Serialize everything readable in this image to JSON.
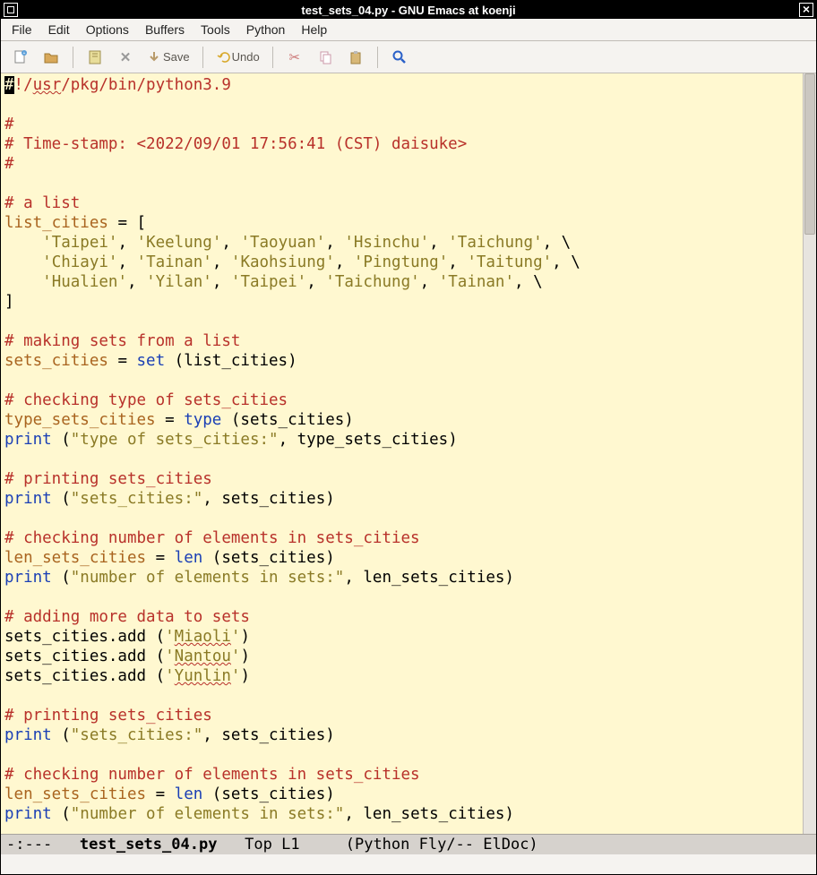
{
  "titlebar": {
    "title": "test_sets_04.py - GNU Emacs at koenji"
  },
  "menu": {
    "file": "File",
    "edit": "Edit",
    "options": "Options",
    "buffers": "Buffers",
    "tools": "Tools",
    "python": "Python",
    "help": "Help"
  },
  "toolbar": {
    "save": "Save",
    "undo": "Undo"
  },
  "modeline": {
    "left": "-:--- ",
    "buffer": "test_sets_04.py",
    "pos": "   Top L1     ",
    "mode": "(Python Fly/-- ElDoc)"
  },
  "code": {
    "shebang_pre": "!/",
    "shebang_usr": "usr",
    "shebang_post": "/pkg/bin/python3.9",
    "blank": " ",
    "hash": "#",
    "timestamp": "# Time-stamp: <2022/09/01 17:56:41 (CST) daisuke>",
    "c_alist": "# a list",
    "list_decl": "list_cities",
    "eq_open": " = [",
    "row1_i": "    ",
    "s_taipei": "'Taipei'",
    "s_keelung": "'Keelung'",
    "s_taoyuan": "'Taoyuan'",
    "s_hsinchu": "'Hsinchu'",
    "s_taichung": "'Taichung'",
    "s_chiayi": "'Chiayi'",
    "s_tainan": "'Tainan'",
    "s_kaohsiung": "'Kaohsiung'",
    "s_pingtung": "'Pingtung'",
    "s_taitung": "'Taitung'",
    "s_hualien": "'Hualien'",
    "s_yilan": "'Yilan'",
    "comma": ", ",
    "bslash": ", \\",
    "close_br": "]",
    "c_makesets": "# making sets from a list",
    "sets_decl": "sets_cities",
    "eq": " = ",
    "set_kw": "set",
    "paren_list": " (list_cities)",
    "c_checktype": "# checking type of sets_cities",
    "type_decl": "type_sets_cities",
    "type_kw": "type",
    "paren_sets": " (sets_cities)",
    "print_kw": "print",
    "s_typeof": "\"type of sets_cities:\"",
    "after_type": ", type_sets_cities)",
    "c_printsets": "# printing sets_cities",
    "s_setscol": "\"sets_cities:\"",
    "after_sets": ", sets_cities)",
    "c_checknum": "# checking number of elements in sets_cities",
    "len_decl": "len_sets_cities",
    "len_kw": "len",
    "s_numel": "\"number of elements in sets:\"",
    "after_len": ", len_sets_cities)",
    "c_adding": "# adding more data to sets",
    "add_pre": "sets_cities.add (",
    "sq": "'",
    "miaoli": "Miaoli",
    "nantou": "Nantou",
    "yunlin": "Yunlin",
    "close_paren": ")",
    "open_paren": " (",
    "cursor_char": "#"
  }
}
